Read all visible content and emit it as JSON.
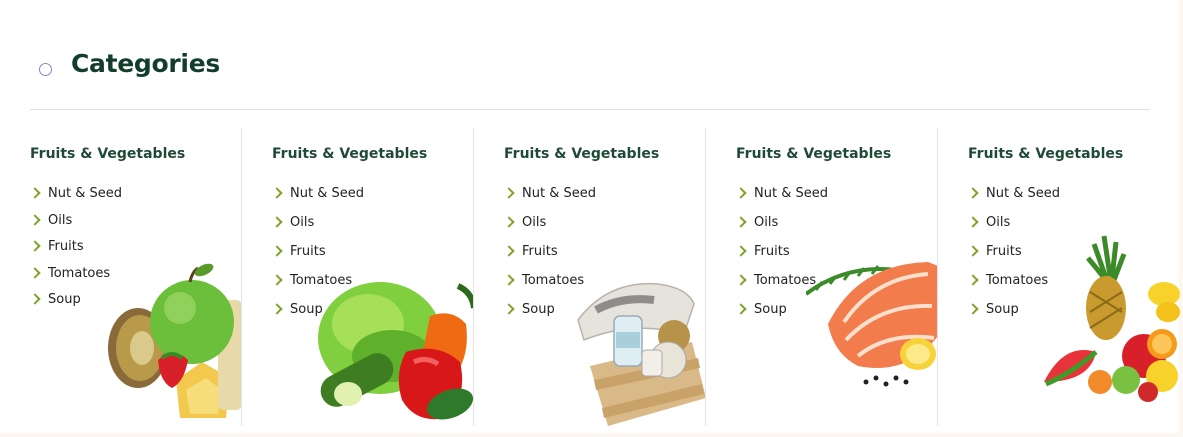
{
  "header": {
    "title": "Categories",
    "bullet_icon": "circle-outline-icon"
  },
  "columns": [
    {
      "title": "Fruits & Vegetables",
      "items": [
        "Nut & Seed",
        "Oils",
        "Fruits",
        "Tomatoes",
        "Soup"
      ],
      "image": "fruit-mix-image"
    },
    {
      "title": "Fruits & Vegetables",
      "items": [
        "Nut & Seed",
        "Oils",
        "Fruits",
        "Tomatoes",
        "Soup"
      ],
      "image": "vegetables-image"
    },
    {
      "title": "Fruits & Vegetables",
      "items": [
        "Nut & Seed",
        "Oils",
        "Fruits",
        "Tomatoes",
        "Soup"
      ],
      "image": "grocery-crate-image"
    },
    {
      "title": "Fruits & Vegetables",
      "items": [
        "Nut & Seed",
        "Oils",
        "Fruits",
        "Tomatoes",
        "Soup"
      ],
      "image": "salmon-image"
    },
    {
      "title": "Fruits & Vegetables",
      "items": [
        "Nut & Seed",
        "Oils",
        "Fruits",
        "Tomatoes",
        "Soup"
      ],
      "image": "tropical-fruits-image"
    }
  ],
  "colors": {
    "heading": "#123d2b",
    "column_title": "#1f4a36",
    "chevron": "#7ea326",
    "bullet": "#9b7bc7",
    "divider": "#e3e3e3"
  }
}
